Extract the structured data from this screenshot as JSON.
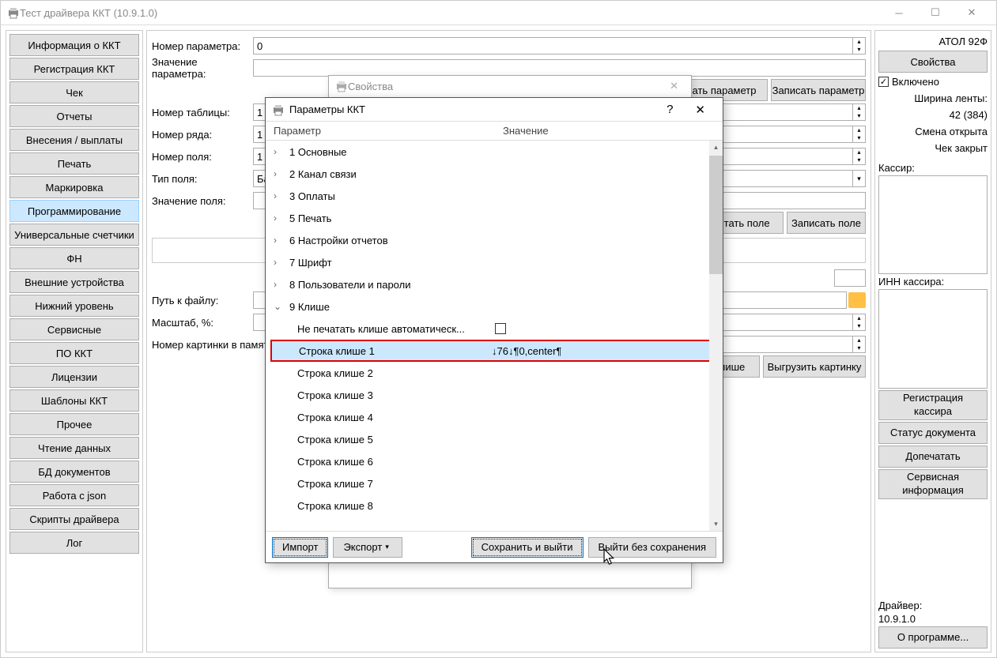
{
  "window": {
    "title": "Тест драйвера ККТ (10.9.1.0)"
  },
  "sidebar": {
    "items": [
      "Информация о ККТ",
      "Регистрация ККТ",
      "Чек",
      "Отчеты",
      "Внесения / выплаты",
      "Печать",
      "Маркировка",
      "Программирование",
      "Универсальные счетчики",
      "ФН",
      "Внешние устройства",
      "Нижний уровень",
      "Сервисные",
      "ПО ККТ",
      "Лицензии",
      "Шаблоны ККТ",
      "Прочее",
      "Чтение данных",
      "БД документов",
      "Работа с json",
      "Скрипты драйвера",
      "Лог"
    ],
    "selected_index": 7
  },
  "form": {
    "param_number_label": "Номер параметра:",
    "param_number_value": "0",
    "param_value_label": "Значение параметра:",
    "table_number_label": "Номер таблицы:",
    "table_number_value": "1",
    "row_number_label": "Номер ряда:",
    "row_number_value": "1",
    "field_number_label": "Номер поля:",
    "field_number_value": "1",
    "field_type_label": "Тип поля:",
    "field_type_value": "Байты",
    "field_value_label": "Значение поля:",
    "file_path_label": "Путь к файлу:",
    "scale_label": "Масштаб, %:",
    "image_memory_label": "Номер картинки в памяти"
  },
  "center_buttons": {
    "read_param": "ать параметр",
    "write_param": "Записать параметр",
    "read_field": "итать поле",
    "write_field": "Записать поле",
    "cliche": "лише",
    "export_image": "Выгрузить картинку"
  },
  "right": {
    "device_model": "АТОЛ 92Ф",
    "properties_btn": "Свойства",
    "enabled_checkbox": "Включено",
    "tape_width_label": "Ширина ленты:",
    "tape_width_value": "42 (384)",
    "shift_status": "Смена открыта",
    "cheque_status": "Чек закрыт",
    "cashier_label": "Кассир:",
    "cashier_inn_label": "ИНН кассира:",
    "register_cashier_btn": "Регистрация кассира",
    "doc_status_btn": "Статус документа",
    "reprint_btn": "Допечатать",
    "service_info_btn": "Сервисная информация",
    "driver_label": "Драйвер:",
    "driver_version": "10.9.1.0",
    "about_btn": "О программе..."
  },
  "bg_dialog": {
    "title": "Свойства"
  },
  "dialog": {
    "title": "Параметры ККТ",
    "header_param": "Параметр",
    "header_value": "Значение",
    "groups": [
      "1 Основные",
      "2 Канал связи",
      "3 Оплаты",
      "5 Печать",
      "6 Настройки отчетов",
      "7 Шрифт",
      "8 Пользователи и пароли",
      "9 Клише"
    ],
    "cliche": {
      "auto_print_label": "Не печатать клише автоматическ...",
      "rows": [
        {
          "label": "Строка клише 1",
          "value": "↓76↓¶0,center¶"
        },
        {
          "label": "Строка клише 2",
          "value": ""
        },
        {
          "label": "Строка клише 3",
          "value": ""
        },
        {
          "label": "Строка клише 4",
          "value": ""
        },
        {
          "label": "Строка клише 5",
          "value": ""
        },
        {
          "label": "Строка клише 6",
          "value": ""
        },
        {
          "label": "Строка клише 7",
          "value": ""
        },
        {
          "label": "Строка клише 8",
          "value": ""
        }
      ]
    },
    "footer": {
      "import": "Импорт",
      "export": "Экспорт",
      "save_exit": "Сохранить и выйти",
      "exit_nosave": "Выйти без сохранения"
    }
  }
}
